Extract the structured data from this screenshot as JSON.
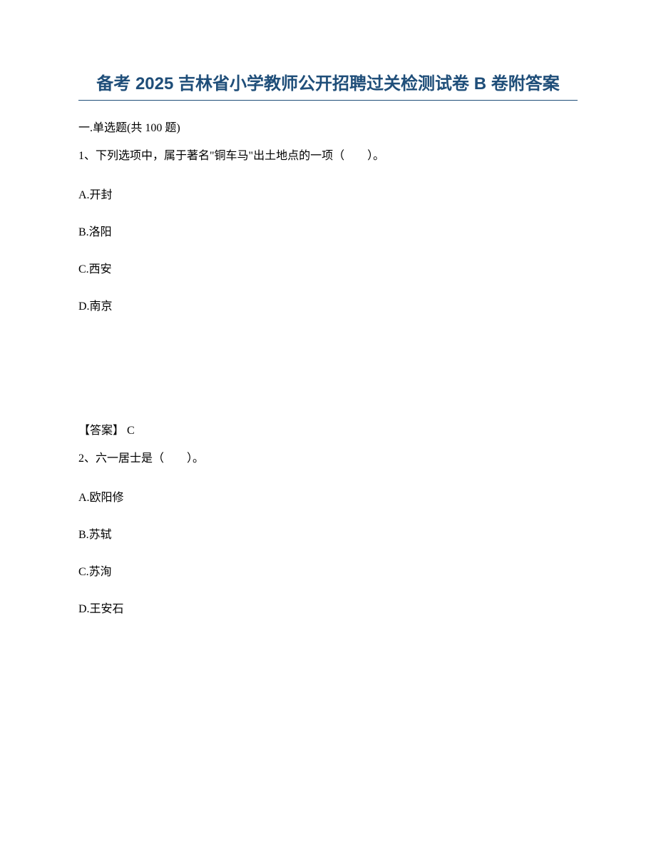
{
  "title": "备考 2025 吉林省小学教师公开招聘过关检测试卷 B 卷附答案",
  "section": "一.单选题(共 100 题)",
  "questions": [
    {
      "stem": "1、下列选项中，属于著名\"铜车马\"出土地点的一项（　　）。",
      "options": {
        "A": "A.开封",
        "B": "B.洛阳",
        "C": "C.西安",
        "D": "D.南京"
      },
      "answer": "【答案】 C"
    },
    {
      "stem": "2、六一居士是（　　）。",
      "options": {
        "A": "A.欧阳修",
        "B": "B.苏轼",
        "C": "C.苏洵",
        "D": "D.王安石"
      }
    }
  ]
}
